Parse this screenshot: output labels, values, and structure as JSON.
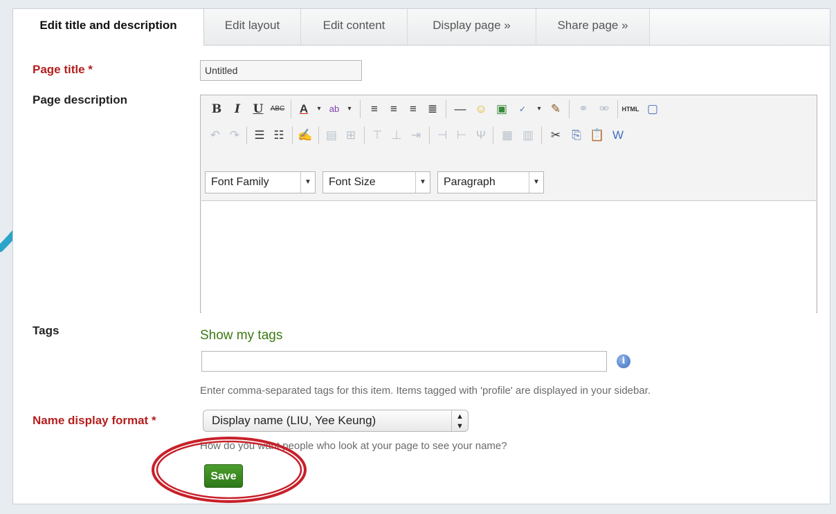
{
  "tabs": [
    {
      "label": "Edit title and description",
      "active": true
    },
    {
      "label": "Edit layout",
      "active": false
    },
    {
      "label": "Edit content",
      "active": false
    },
    {
      "label": "Display page »",
      "active": false
    },
    {
      "label": "Share page »",
      "active": false
    }
  ],
  "form": {
    "page_title_label": "Page title *",
    "page_title_value": "Untitled",
    "page_description_label": "Page description",
    "tags_label": "Tags",
    "show_tags_link": "Show my tags",
    "tags_value": "",
    "tags_hint": "Enter comma-separated tags for this item. Items tagged with 'profile' are displayed in your sidebar.",
    "name_format_label": "Name display format *",
    "name_format_value": "Display name (LIU, Yee Keung)",
    "name_format_hint": "How do you want people who look at your page to see your name?",
    "save_label": "Save"
  },
  "editor": {
    "font_family_label": "Font Family",
    "font_size_label": "Font Size",
    "format_label": "Paragraph",
    "toolbar_row1_icons": [
      "bold-icon",
      "italic-icon",
      "underline-icon",
      "strikethrough-icon",
      "text-color-icon",
      "highlight-color-icon",
      "align-left-icon",
      "align-center-icon",
      "align-right-icon",
      "justify-icon",
      "horizontal-rule-icon",
      "emoticon-icon",
      "image-icon",
      "spellcheck-icon",
      "cleanup-icon",
      "link-icon",
      "unlink-icon",
      "html-source-icon",
      "fullscreen-icon"
    ],
    "toolbar_row2_icons": [
      "undo-icon",
      "redo-icon",
      "bullet-list-icon",
      "numbered-list-icon",
      "edit-icon",
      "table-icon",
      "table-merge-icon",
      "row-before-icon",
      "row-after-icon",
      "delete-row-icon",
      "col-before-icon",
      "col-after-icon",
      "delete-col-icon",
      "split-cells-icon",
      "merge-cells-icon",
      "cut-icon",
      "copy-icon",
      "paste-icon",
      "paste-word-icon"
    ],
    "html_glyph": "HTML"
  },
  "colors": {
    "required_label": "#b41e1e",
    "link_green": "#3a7a12",
    "save_green": "#3a8a22",
    "annotation_red": "#c8202a"
  }
}
